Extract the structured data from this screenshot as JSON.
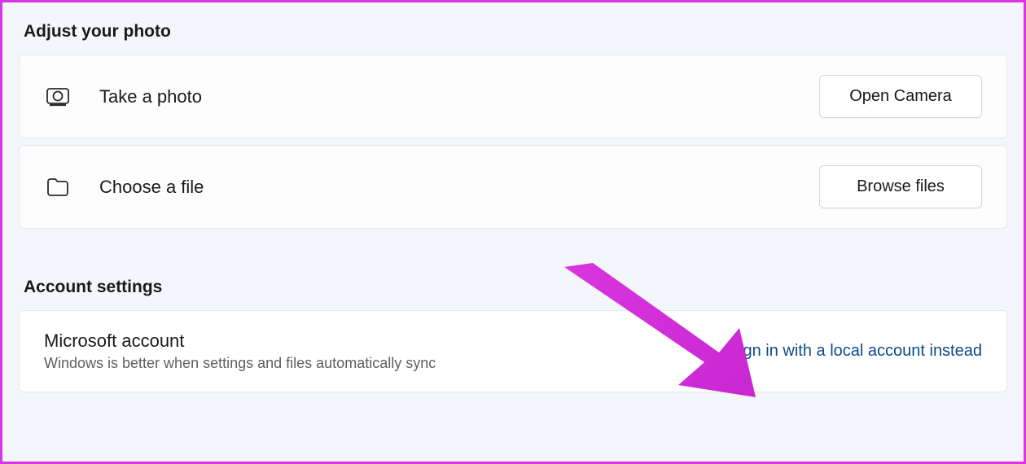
{
  "sections": {
    "photo": {
      "title": "Adjust your photo",
      "rows": {
        "take_photo": {
          "icon": "camera-icon",
          "label": "Take a photo",
          "button": "Open Camera"
        },
        "choose_file": {
          "icon": "folder-icon",
          "label": "Choose a file",
          "button": "Browse files"
        }
      }
    },
    "account": {
      "title": "Account settings",
      "microsoft": {
        "title": "Microsoft account",
        "subtitle": "Windows is better when settings and files automatically sync",
        "link": "Sign in with a local account instead"
      }
    }
  },
  "annotation": {
    "arrow_color": "#d935e0"
  }
}
